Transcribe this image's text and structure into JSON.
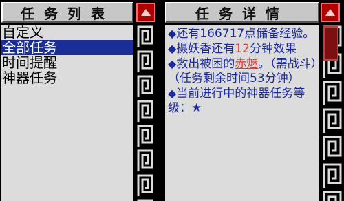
{
  "left_panel": {
    "title": "任务列表",
    "items": [
      {
        "label": "自定义",
        "selected": false
      },
      {
        "label": "全部任务",
        "selected": true
      },
      {
        "label": "时间提醒",
        "selected": false
      },
      {
        "label": "神器任务",
        "selected": false
      }
    ]
  },
  "right_panel": {
    "title": "任务详情",
    "entries": {
      "e1": {
        "bullet": "◆",
        "text": "还有166717点储备经验。"
      },
      "e2": {
        "bullet": "◆",
        "pre": "摄妖香还有",
        "num": "12",
        "post": "分钟效果"
      },
      "e3": {
        "bullet": "◆",
        "pre": "救出被困的",
        "name": "赤魅",
        "post": "。（需战斗）（任务剩余时间53分钟）"
      },
      "e4": {
        "bullet": "◆",
        "text": "当前进行中的神器任务等级：",
        "star": "★"
      }
    }
  },
  "colors": {
    "panel_bg": "#dcdcdc",
    "title_bg": "#c7c7c7",
    "selection": "#1b2d96",
    "detail_text": "#1a2aa0",
    "highlight": "#d83a3a",
    "scroll_button": "#b00000"
  },
  "icons": {
    "scroll_up": "scroll-up-arrow-icon",
    "pattern": "greek-key-meander-icon",
    "bullet": "diamond-bullet-icon",
    "star": "star-icon"
  }
}
